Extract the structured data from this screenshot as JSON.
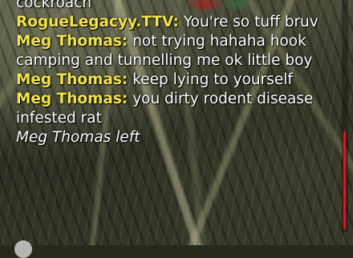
{
  "chat": {
    "messages": [
      {
        "author": "",
        "text": "cockroach",
        "system": false
      },
      {
        "author": "RogueLegacyy.TTV:",
        "text": " You're so tuff bruv",
        "system": false
      },
      {
        "author": "Meg Thomas:",
        "text": " not trying hahaha hook camping and tunnelling me ok little boy",
        "system": false
      },
      {
        "author": "Meg Thomas:",
        "text": " keep lying to yourself",
        "system": false
      },
      {
        "author": "Meg Thomas:",
        "text": " you dirty rodent disease infested rat",
        "system": false
      },
      {
        "author": "",
        "text": "Meg Thomas left",
        "system": true
      }
    ]
  },
  "colors": {
    "author_name": "#f2e34c",
    "message_text": "#ffffff",
    "scroll_thumb": "#e0161e"
  },
  "icons": {
    "bottom_indicator": "circle-icon"
  }
}
